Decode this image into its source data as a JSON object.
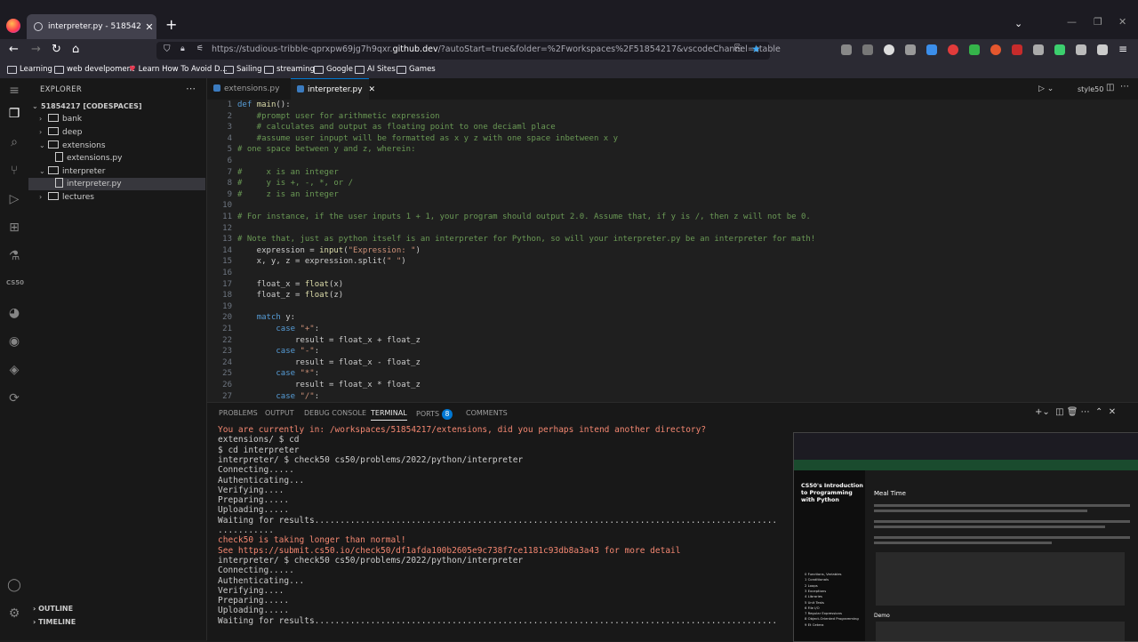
{
  "browser": {
    "tab_title": "interpreter.py - 51854217 [Codespaces",
    "url_prefix": "https://studious-tribble-qprxpw69jg7h9qxr.",
    "url_domain": "github.dev",
    "url_suffix": "/?autoStart=true&folder=%2Fworkspaces%2F51854217&vscodeChannel=stable",
    "new_tab": "+",
    "bookmarks": [
      "Learning",
      "web develpoment",
      "Learn How To Avoid D...",
      "Sailing",
      "streaming",
      "Google",
      "AI Sites",
      "Games"
    ]
  },
  "explorer": {
    "title": "EXPLORER",
    "root": "51854217 [CODESPACES]",
    "tree": [
      {
        "label": "bank",
        "type": "folder",
        "depth": 1,
        "open": false
      },
      {
        "label": "deep",
        "type": "folder",
        "depth": 1,
        "open": false
      },
      {
        "label": "extensions",
        "type": "folder",
        "depth": 1,
        "open": true
      },
      {
        "label": "extensions.py",
        "type": "file",
        "depth": 2
      },
      {
        "label": "interpreter",
        "type": "folder",
        "depth": 1,
        "open": true
      },
      {
        "label": "interpreter.py",
        "type": "file",
        "depth": 2,
        "selected": true
      },
      {
        "label": "lectures",
        "type": "folder",
        "depth": 1,
        "open": false
      }
    ],
    "outline": "OUTLINE",
    "timeline": "TIMELINE",
    "cs50_label": "CS50"
  },
  "editor": {
    "tabs": [
      "extensions.py",
      "interpreter.py"
    ],
    "active_tab": "interpreter.py",
    "run_label": "style50",
    "lines": [
      "def main():",
      "    #prompt user for arithmetic expression",
      "    # calculates and output as floating point to one deciaml place",
      "    #assume user inpupt will be formatted as x y z with one space inbetween x y",
      "# one space between y and z, wherein:",
      "",
      "#     x is an integer",
      "#     y is +, -, *, or /",
      "#     z is an integer",
      "",
      "# For instance, if the user inputs 1 + 1, your program should output 2.0. Assume that, if y is /, then z will not be 0.",
      "",
      "# Note that, just as python itself is an interpreter for Python, so will your interpreter.py be an interpreter for math!",
      "    expression = input(\"Expression: \")",
      "    x, y, z = expression.split(\" \")",
      "",
      "    float_x = float(x)",
      "    float_z = float(z)",
      "",
      "    match y:",
      "        case \"+\":",
      "            result = float_x + float_z",
      "        case \"-\":",
      "            result = float_x - float_z",
      "        case \"*\":",
      "            result = float_x * float_z",
      "        case \"/\":"
    ]
  },
  "panel": {
    "tabs": [
      "PROBLEMS",
      "OUTPUT",
      "DEBUG CONSOLE",
      "TERMINAL",
      "PORTS",
      "COMMENTS"
    ],
    "ports_count": "8",
    "active": "TERMINAL",
    "terminal": [
      {
        "text": "You are currently in: /workspaces/51854217/extensions, did you perhaps intend another directory?",
        "warn": true
      },
      {
        "text": "extensions/ $ cd",
        "warn": false
      },
      {
        "text": "$ cd interpreter",
        "warn": false
      },
      {
        "text": "interpreter/ $ check50 cs50/problems/2022/python/interpreter",
        "warn": false
      },
      {
        "text": "Connecting.....",
        "warn": false
      },
      {
        "text": "Authenticating...",
        "warn": false
      },
      {
        "text": "Verifying....",
        "warn": false
      },
      {
        "text": "Preparing.....",
        "warn": false
      },
      {
        "text": "Uploading.....",
        "warn": false
      },
      {
        "text": "Waiting for results...........................................................................................",
        "warn": false
      },
      {
        "text": "...........",
        "warn": false
      },
      {
        "text": "check50 is taking longer than normal!",
        "warn": true
      },
      {
        "text": "See https://submit.cs50.io/check50/df1afda100b2605e9c738f7ce1181c93db8a3a43 for more detail",
        "warn": true
      },
      {
        "text": "interpreter/ $ check50 cs50/problems/2022/python/interpreter",
        "warn": false
      },
      {
        "text": "Connecting.....",
        "warn": false
      },
      {
        "text": "Authenticating...",
        "warn": false
      },
      {
        "text": "Verifying....",
        "warn": false
      },
      {
        "text": "Preparing.....",
        "warn": false
      },
      {
        "text": "Uploading.....",
        "warn": false
      },
      {
        "text": "Waiting for results...........................................................................................",
        "warn": false
      }
    ]
  },
  "pip": {
    "course_title": "CS50's Introduction to Programming with Python",
    "page_heading": "Meal Time",
    "demo_heading": "Demo",
    "nav_items": [
      "0 Functions, Variables",
      "1 Conditionals",
      "2 Loops",
      "3 Exceptions",
      "4 Libraries",
      "5 Unit Tests",
      "6 File I/O",
      "7 Regular Expressions",
      "8 Object-Oriented Programming",
      "9 Et Cetera"
    ]
  },
  "colors": {
    "accent": "#0078d4",
    "keyword": "#569cd6",
    "comment": "#6a9955",
    "string": "#ce9178",
    "warn": "#f48771"
  }
}
